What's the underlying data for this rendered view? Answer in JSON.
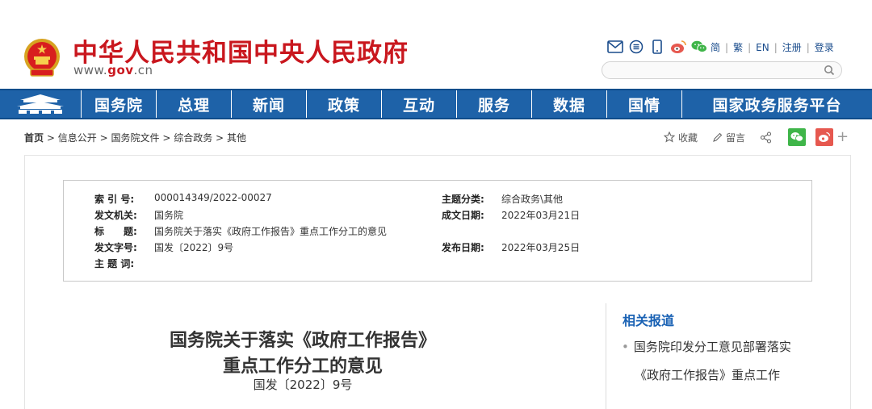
{
  "header": {
    "site_title": "中华人民共和国中央人民政府",
    "site_url_prefix": "www.",
    "site_url_mid": "gov",
    "site_url_suffix": ".cn",
    "top_links": [
      "简",
      "繁",
      "EN",
      "注册",
      "登录"
    ],
    "search_placeholder": ""
  },
  "nav": {
    "items": [
      "国务院",
      "总理",
      "新闻",
      "政策",
      "互动",
      "服务",
      "数据",
      "国情",
      "国家政务服务平台"
    ]
  },
  "breadcrumb": {
    "items": [
      "首页",
      "信息公开",
      "国务院文件",
      "综合政务",
      "其他"
    ],
    "separator": ">"
  },
  "share": {
    "favorite": "收藏",
    "comment": "留言"
  },
  "info": {
    "index_label": "索 引 号:",
    "index_value": "000014349/2022-00027",
    "topic_label": "主题分类:",
    "topic_value": "综合政务\\其他",
    "issuer_label": "发文机关:",
    "issuer_value": "国务院",
    "date_label": "成文日期:",
    "date_value": "2022年03月21日",
    "title_label": "标　　题:",
    "title_value": "国务院关于落实《政府工作报告》重点工作分工的意见",
    "doc_no_label": "发文字号:",
    "doc_no_value": "国发〔2022〕9号",
    "pub_date_label": "发布日期:",
    "pub_date_value": "2022年03月25日",
    "keywords_label": "主 题 词:",
    "keywords_value": ""
  },
  "article": {
    "title_line1": "国务院关于落实《政府工作报告》",
    "title_line2": "重点工作分工的意见",
    "doc_number": "国发〔2022〕9号"
  },
  "related": {
    "title": "相关报道",
    "item_line1": "国务院印发分工意见部署落实",
    "item_line2": "《政府工作报告》重点工作"
  },
  "colors": {
    "brand_red": "#c9171e",
    "nav_blue": "#1e62a8",
    "link_blue": "#1a62b4",
    "wechat_green": "#3fb549",
    "weibo_red": "#e6584f"
  }
}
